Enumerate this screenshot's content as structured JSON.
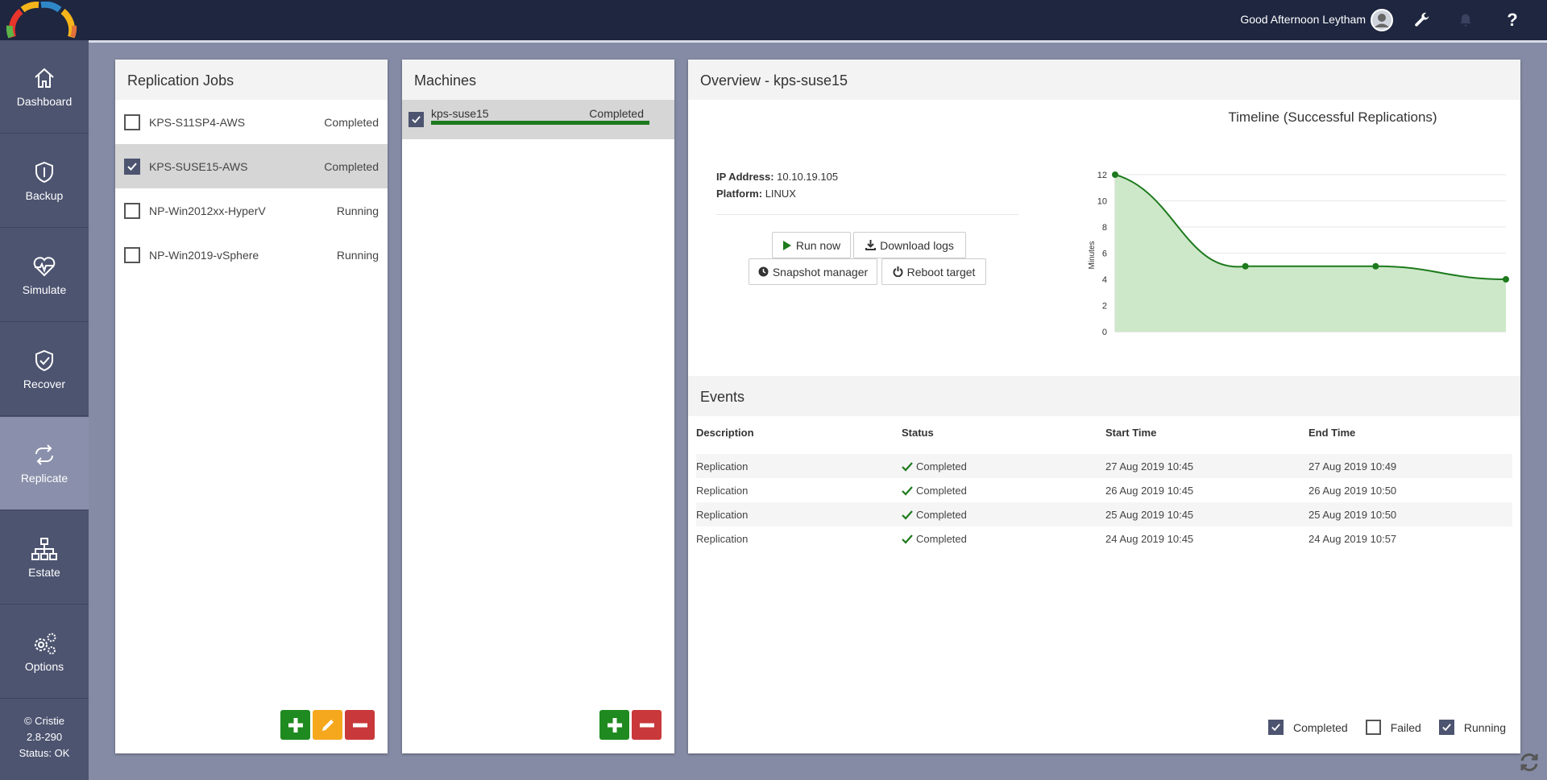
{
  "header": {
    "greeting": "Good Afternoon Leytham"
  },
  "sidebar": {
    "items": [
      {
        "label": "Dashboard",
        "icon": "home-icon"
      },
      {
        "label": "Backup",
        "icon": "shield-icon"
      },
      {
        "label": "Simulate",
        "icon": "heartbeat-icon"
      },
      {
        "label": "Recover",
        "icon": "shield-check-icon"
      },
      {
        "label": "Replicate",
        "icon": "replicate-icon"
      },
      {
        "label": "Estate",
        "icon": "network-icon"
      },
      {
        "label": "Options",
        "icon": "gears-icon"
      }
    ],
    "active": "Replicate",
    "footer": {
      "copyright": "© Cristie",
      "version": "2.8-290",
      "status": "Status: OK"
    }
  },
  "jobs": {
    "title": "Replication Jobs",
    "rows": [
      {
        "name": "KPS-S11SP4-AWS",
        "status": "Completed",
        "checked": false
      },
      {
        "name": "KPS-SUSE15-AWS",
        "status": "Completed",
        "checked": true
      },
      {
        "name": "NP-Win2012xx-HyperV",
        "status": "Running",
        "checked": false
      },
      {
        "name": "NP-Win2019-vSphere",
        "status": "Running",
        "checked": false
      }
    ]
  },
  "machines": {
    "title": "Machines",
    "rows": [
      {
        "name": "kps-suse15",
        "status": "Completed",
        "checked": true,
        "progress": 1.0
      }
    ]
  },
  "overview": {
    "title": "Overview - kps-suse15",
    "ip_label": "IP Address:",
    "ip_value": "10.10.19.105",
    "platform_label": "Platform:",
    "platform_value": "LINUX",
    "actions": {
      "run_now": "Run now",
      "download_logs": "Download logs",
      "snapshot_manager": "Snapshot manager",
      "reboot_target": "Reboot target"
    }
  },
  "chart_data": {
    "type": "area",
    "title": "Timeline (Successful Replications)",
    "ylabel": "Minutes",
    "xlabel": "",
    "ylim": [
      0,
      12
    ],
    "yticks": [
      0,
      2,
      4,
      6,
      8,
      10,
      12
    ],
    "x": [
      1,
      2,
      3,
      4
    ],
    "values": [
      12,
      5,
      5,
      4
    ],
    "grid": true,
    "fill_color": "#cde8c9",
    "line_color": "#1d7a1d"
  },
  "events": {
    "title": "Events",
    "columns": [
      "Description",
      "Status",
      "Start Time",
      "End Time"
    ],
    "rows": [
      {
        "description": "Replication",
        "status": "Completed",
        "start": "27 Aug 2019 10:45",
        "end": "27 Aug 2019 10:49"
      },
      {
        "description": "Replication",
        "status": "Completed",
        "start": "26 Aug 2019 10:45",
        "end": "26 Aug 2019 10:50"
      },
      {
        "description": "Replication",
        "status": "Completed",
        "start": "25 Aug 2019 10:45",
        "end": "25 Aug 2019 10:50"
      },
      {
        "description": "Replication",
        "status": "Completed",
        "start": "24 Aug 2019 10:45",
        "end": "24 Aug 2019 10:57"
      }
    ]
  },
  "legend": {
    "completed": {
      "label": "Completed",
      "checked": true
    },
    "failed": {
      "label": "Failed",
      "checked": false
    },
    "running": {
      "label": "Running",
      "checked": true
    }
  },
  "colors": {
    "topbar": "#1e2640",
    "sidebar": "#4d5470",
    "sidebar_active": "#8a90ab",
    "success": "#1d7a1d",
    "add_button": "#1f8a1f",
    "edit_button": "#f5a81e",
    "remove_button": "#c9383a"
  }
}
